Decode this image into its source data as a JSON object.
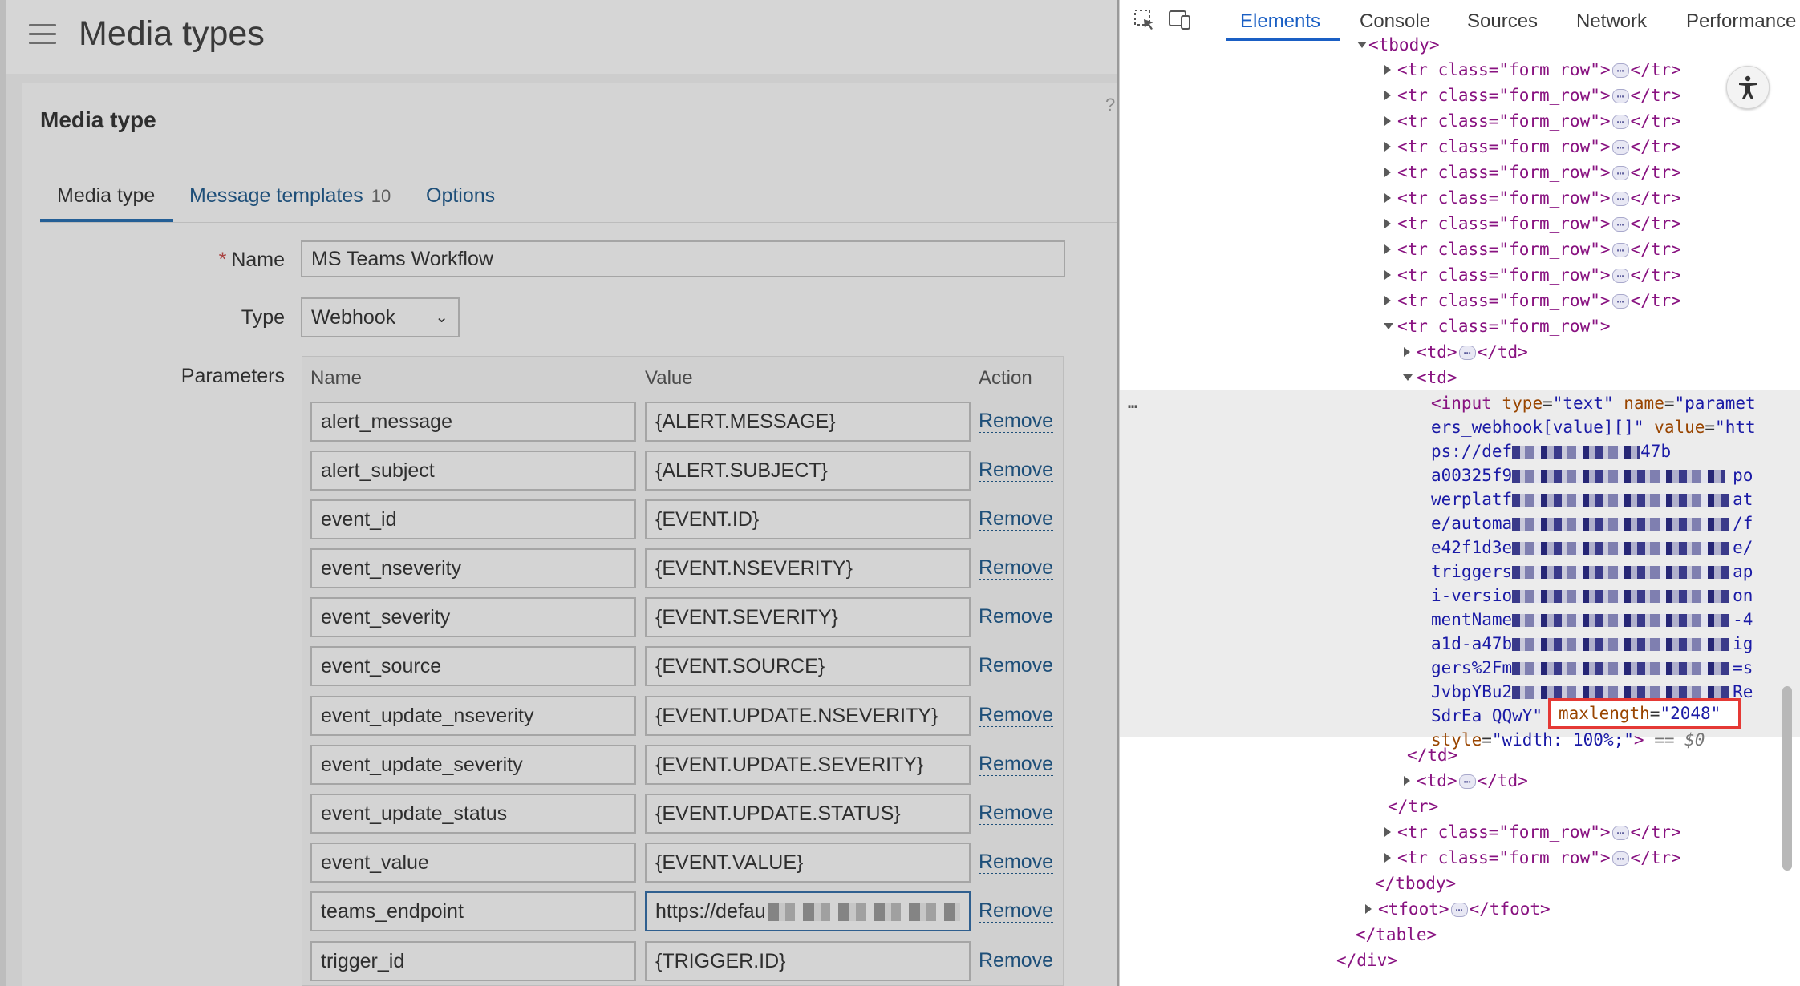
{
  "app": {
    "page_title": "Media types",
    "card_title": "Media type",
    "help": "?",
    "tabs": [
      {
        "label": "Media type"
      },
      {
        "label": "Message templates",
        "count": "10"
      },
      {
        "label": "Options"
      }
    ],
    "form": {
      "name_label": "Name",
      "required_mark": "*",
      "name_value": "MS Teams Workflow",
      "type_label": "Type",
      "type_value": "Webhook",
      "parameters_label": "Parameters",
      "columns": {
        "name": "Name",
        "value": "Value",
        "action": "Action"
      },
      "remove_label": "Remove",
      "parameters": [
        {
          "name": "alert_message",
          "value": "{ALERT.MESSAGE}"
        },
        {
          "name": "alert_subject",
          "value": "{ALERT.SUBJECT}"
        },
        {
          "name": "event_id",
          "value": "{EVENT.ID}"
        },
        {
          "name": "event_nseverity",
          "value": "{EVENT.NSEVERITY}"
        },
        {
          "name": "event_severity",
          "value": "{EVENT.SEVERITY}"
        },
        {
          "name": "event_source",
          "value": "{EVENT.SOURCE}"
        },
        {
          "name": "event_update_nseverity",
          "value": "{EVENT.UPDATE.NSEVERITY}"
        },
        {
          "name": "event_update_severity",
          "value": "{EVENT.UPDATE.SEVERITY}"
        },
        {
          "name": "event_update_status",
          "value": "{EVENT.UPDATE.STATUS}"
        },
        {
          "name": "event_value",
          "value": "{EVENT.VALUE}"
        },
        {
          "name": "teams_endpoint",
          "value": "https://defau"
        },
        {
          "name": "trigger_id",
          "value": "{TRIGGER.ID}"
        }
      ]
    }
  },
  "devtools": {
    "tabs": [
      "Elements",
      "Console",
      "Sources",
      "Network",
      "Performance"
    ],
    "active_tab": "Elements",
    "tree": {
      "tbody_open": "<tbody>",
      "form_row": "<tr class=\"form_row\">",
      "tr_close": "</tr>",
      "td_open": "<td>",
      "td_close": "</td>",
      "td_line_close": "</td>",
      "tr_line_close": "</tr>",
      "tbody_close": "</tbody>",
      "tfoot_open": "<tfoot>",
      "tfoot_close": "</tfoot>",
      "table_close": "</table>",
      "div_close": "</div>",
      "row_dots": "…",
      "input_lines": [
        "<input type=\"text\" name=\"paramet",
        "ers_webhook[value][]\" value=\"htt",
        "ps://def",
        "a00325f9",
        "werplatf",
        "e/automa",
        "e42f1d3e",
        "triggers",
        "i-versio",
        "mentName",
        "a1d-a47b",
        "gers%2Fm",
        "JvbpYBu2",
        "SdrEa_QQwY\""
      ],
      "input_line_tails": [
        "",
        "",
        "47b",
        "po",
        "at",
        "/f",
        "e/",
        "ap",
        "on",
        "-4",
        "ig",
        "=s",
        "Re",
        ""
      ],
      "style_line": "style=\"width: 100%;\">",
      "dollar_ref": " == $0",
      "maxlength_attr": "maxlength",
      "maxlength_value": "\"2048\""
    }
  }
}
